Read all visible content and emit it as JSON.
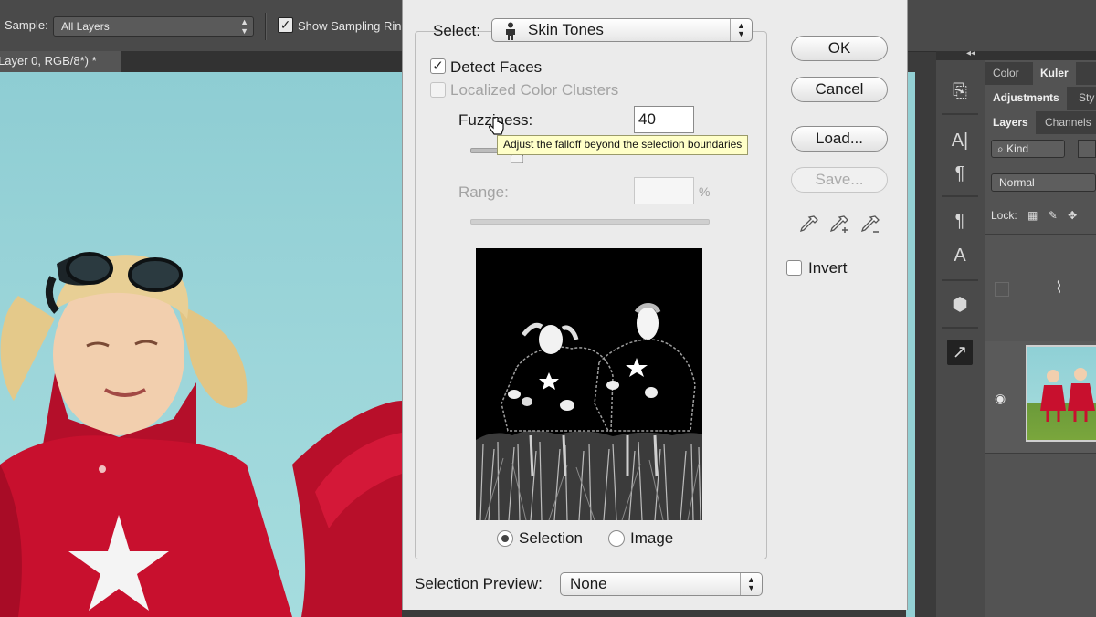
{
  "options_bar": {
    "sample_label": "Sample:",
    "sample_value": "All Layers",
    "show_sampling_ring_checked": true,
    "show_sampling_ring_label": "Show Sampling Ring"
  },
  "document": {
    "tab_title": "Layer 0, RGB/8*) *"
  },
  "dialog": {
    "select_label": "Select:",
    "select_value": "Skin Tones",
    "select_icon": "person-icon",
    "detect_faces_label": "Detect Faces",
    "detect_faces_checked": true,
    "localized_label": "Localized Color Clusters",
    "localized_checked": false,
    "fuzziness_label": "Fuzziness:",
    "fuzziness_value": "40",
    "tooltip": "Adjust the falloff beyond the selection boundaries",
    "range_label": "Range:",
    "range_value": "",
    "range_unit": "%",
    "preview_mode_selection": "Selection",
    "preview_mode_image": "Image",
    "preview_mode_selected": "Selection",
    "selection_preview_label": "Selection Preview:",
    "selection_preview_value": "None",
    "buttons": {
      "ok": "OK",
      "cancel": "Cancel",
      "load": "Load...",
      "save": "Save..."
    },
    "eyedroppers": [
      "eyedropper-icon",
      "eyedropper-plus-icon",
      "eyedropper-minus-icon"
    ],
    "invert_label": "Invert",
    "invert_checked": false
  },
  "panels": {
    "tabs_row1": [
      "Color",
      "Kuler"
    ],
    "tabs_row2": [
      "Adjustments",
      "Sty"
    ],
    "tabs_row3": [
      "Layers",
      "Channels"
    ],
    "kind_label": "Kind",
    "blend_mode": "Normal",
    "lock_label": "Lock:"
  },
  "colors": {
    "dialog_bg": "#ebebeb",
    "sky": "#9dd6da",
    "cape_red": "#c8102e",
    "panel_dark": "#4a4a4a"
  }
}
